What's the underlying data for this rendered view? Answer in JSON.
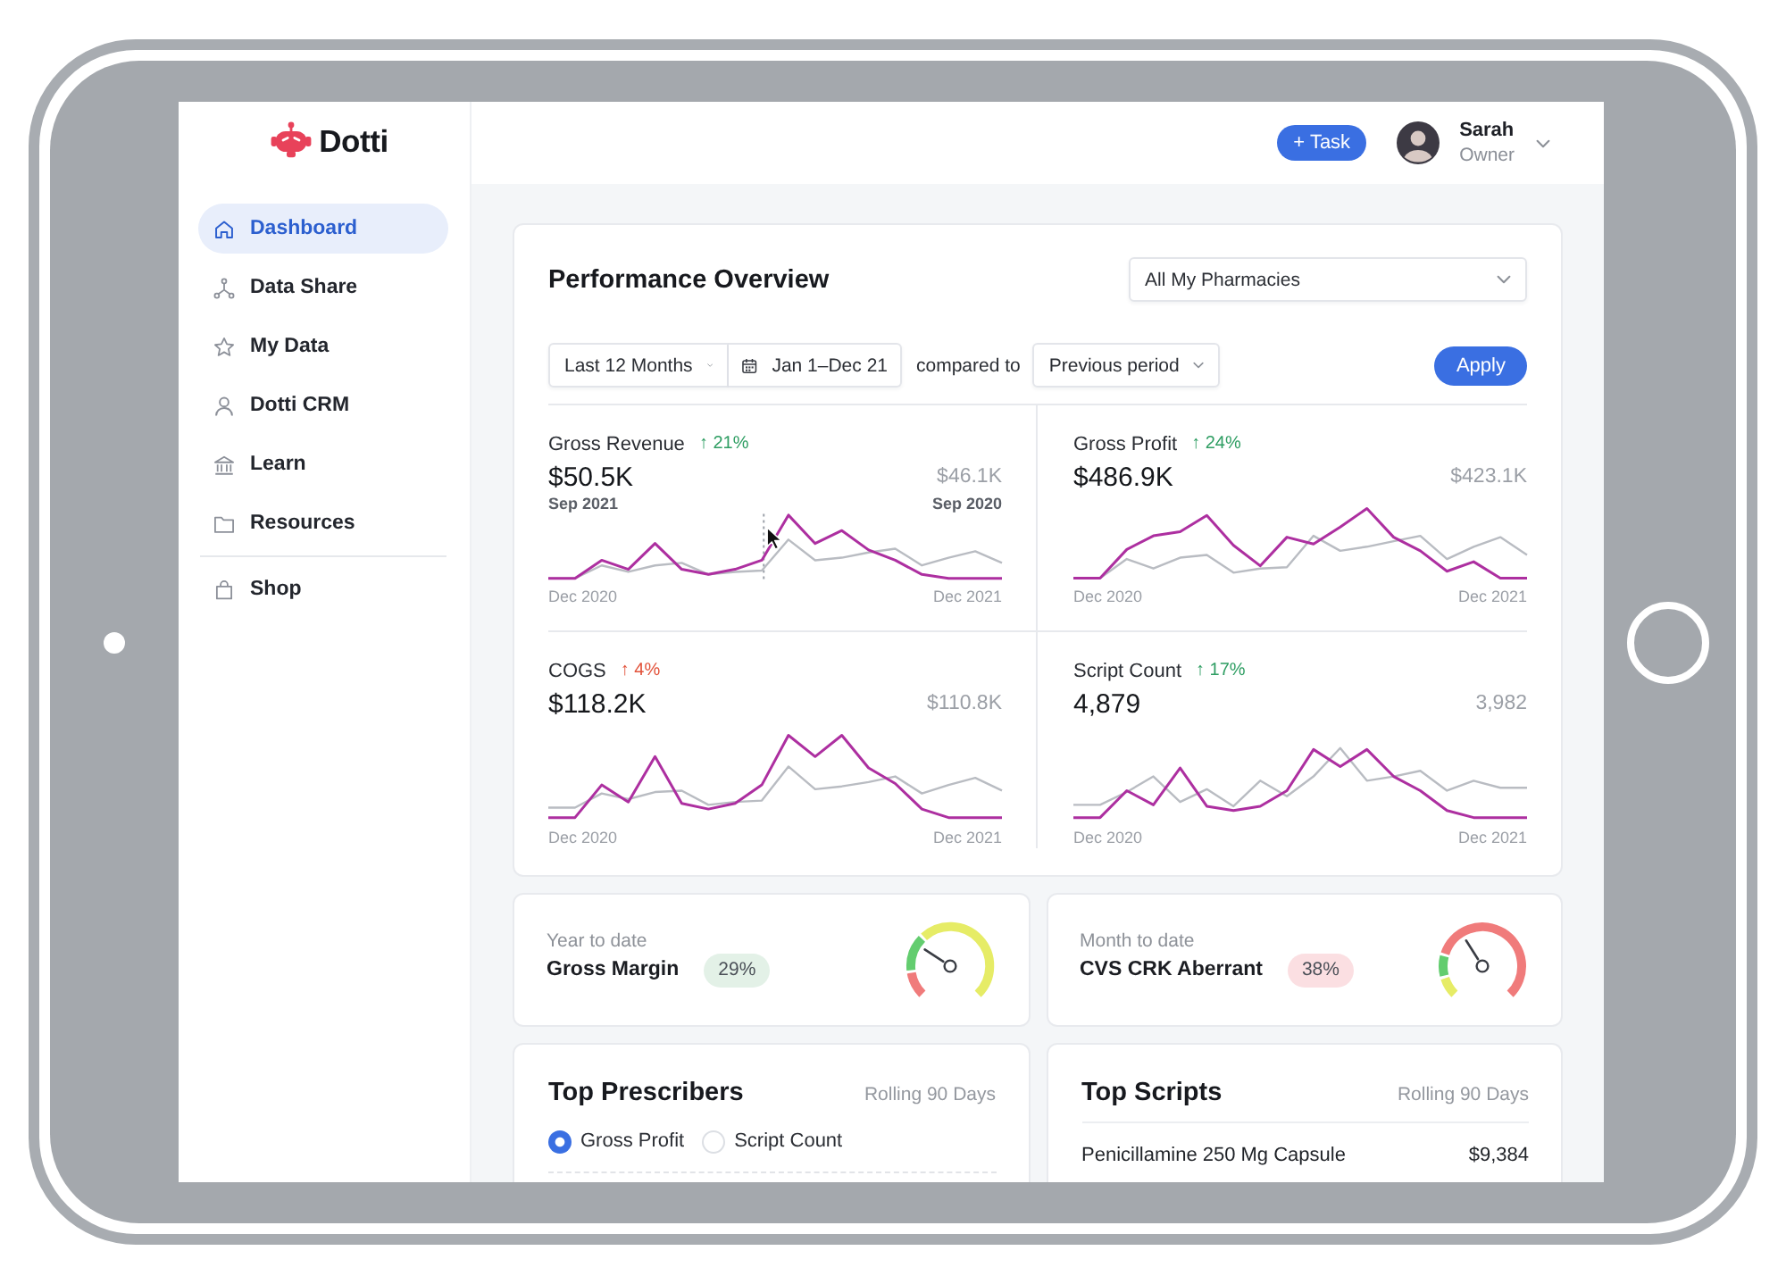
{
  "sidebar": {
    "logo": "Dotti",
    "items": [
      {
        "label": "Dashboard",
        "selected": true
      },
      {
        "label": "Data Share",
        "selected": false
      },
      {
        "label": "My Data",
        "selected": false
      },
      {
        "label": "Dotti CRM",
        "selected": false
      },
      {
        "label": "Learn",
        "selected": false
      },
      {
        "label": "Resources",
        "selected": false
      }
    ],
    "footer_items": [
      {
        "label": "Shop",
        "selected": false
      }
    ]
  },
  "header": {
    "task_button": "+ Task",
    "user": {
      "name": "Sarah",
      "role": "Owner"
    }
  },
  "performance": {
    "title": "Performance Overview",
    "scope_dropdown": "All My Pharmacies",
    "range_dropdown": "Last 12 Months",
    "date_range": "Jan 1–Dec 21",
    "compare_label": "compared to",
    "compare_dropdown": "Previous period",
    "apply_button": "Apply",
    "metrics": [
      {
        "label": "Gross Revenue",
        "change": {
          "text": "↑ 21%",
          "color": "#2f9e63"
        },
        "value": "$50.5K",
        "previous_value": "$46.1K",
        "hover": {
          "current_date": "Sep 2021",
          "previous_date": "Sep 2020"
        },
        "start_label": "Dec 2020",
        "end_label": "Dec 2021"
      },
      {
        "label": "Gross Profit",
        "change": {
          "text": "↑ 24%",
          "color": "#2f9e63"
        },
        "value": "$486.9K",
        "previous_value": "$423.1K",
        "start_label": "Dec 2020",
        "end_label": "Dec 2021"
      },
      {
        "label": "COGS",
        "change": {
          "text": "↑ 4%",
          "color": "#e2533b"
        },
        "value": "$118.2K",
        "previous_value": "$110.8K",
        "start_label": "Dec 2020",
        "end_label": "Dec 2021"
      },
      {
        "label": "Script Count",
        "change": {
          "text": "↑ 17%",
          "color": "#2f9e63"
        },
        "value": "4,879",
        "previous_value": "3,982",
        "start_label": "Dec 2020",
        "end_label": "Dec 2021"
      }
    ]
  },
  "gauges": [
    {
      "period": "Year to date",
      "label": "Gross Margin",
      "badge": "29%",
      "color": "#e3f1e7",
      "kind": "margin",
      "level": 0.29
    },
    {
      "period": "Month to date",
      "label": "CVS CRK Aberrant",
      "badge": "38%",
      "color": "#fbdfe2",
      "kind": "risk",
      "level": 0.38
    }
  ],
  "top_prescribers": {
    "title": "Top Prescribers",
    "period": "Rolling 90 Days",
    "options": [
      {
        "label": "Gross Profit",
        "selected": true
      },
      {
        "label": "Script Count",
        "selected": false
      }
    ]
  },
  "top_scripts": {
    "title": "Top Scripts",
    "period": "Rolling 90 Days",
    "rows": [
      {
        "name": "Penicillamine 250 Mg Capsule",
        "value": "$9,384"
      }
    ]
  }
}
